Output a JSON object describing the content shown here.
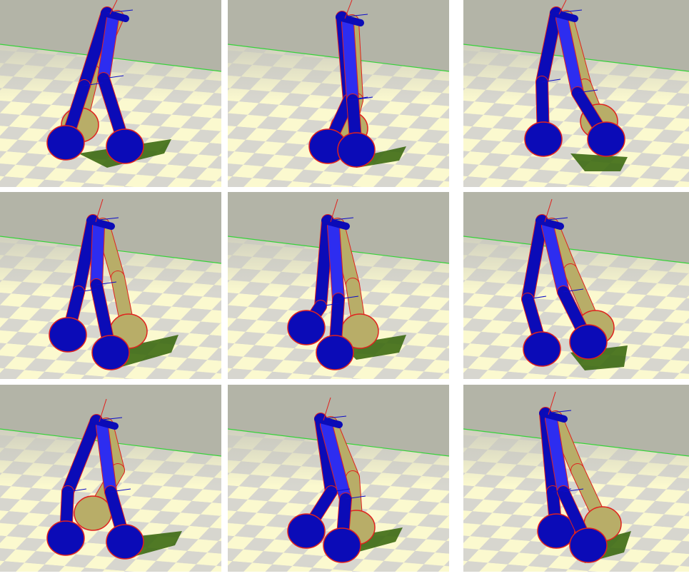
{
  "figure": {
    "rows": 3,
    "columns": 3,
    "colors": {
      "sky": "#b3b4a7",
      "floor_light": "#fbf9cf",
      "floor_dark": "#8f8f8f",
      "horizon_line": "#37d23a",
      "leg_blue": "#0b0bb7",
      "leg_blue_light": "#2d2df0",
      "leg_gold": "#b8ad68",
      "outline_red": "#e0221e",
      "shadow_green": "#3d6a12",
      "joint_axis_blue": "#0c0cc8"
    },
    "panels": [
      {
        "pose": "walking-stride-1"
      },
      {
        "pose": "knee-bent-1"
      },
      {
        "pose": "walking-stride-2"
      },
      {
        "pose": "walking-stride-3"
      },
      {
        "pose": "knee-bent-2"
      },
      {
        "pose": "walking-stride-4"
      },
      {
        "pose": "walking-stride-5"
      },
      {
        "pose": "knee-bent-3"
      },
      {
        "pose": "walking-stride-6"
      }
    ]
  }
}
